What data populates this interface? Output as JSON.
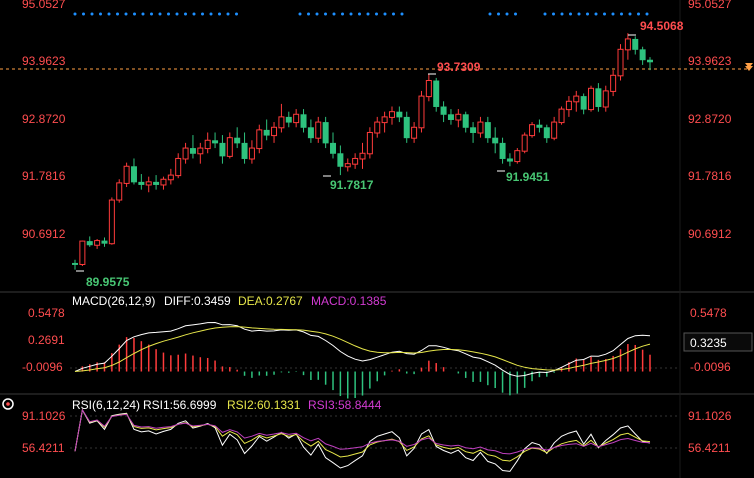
{
  "main_panel": {
    "price_axis_left": [
      "95.0527",
      "93.9623",
      "92.8720",
      "91.7816",
      "90.6912"
    ],
    "price_axis_right": [
      "95.0527",
      "93.9623",
      "92.8720",
      "91.7816",
      "90.6912"
    ],
    "current_price": "93.9623",
    "annotations": {
      "low_start": "89.9575",
      "high_mid": "93.7309",
      "low_left": "91.7817",
      "low_right": "91.9451",
      "high_last": "94.5068"
    }
  },
  "macd_panel": {
    "title": "MACD(26,12,9)",
    "diff": "DIFF:0.3459",
    "dea": "DEA:0.2767",
    "macd": "MACD:0.1385",
    "axis_left": [
      "0.5478",
      "0.2691",
      "-0.0096"
    ],
    "axis_right": [
      "0.5478",
      "0.3235",
      "-0.0096"
    ]
  },
  "rsi_panel": {
    "title": "RSI(6,12,24)",
    "rsi1": "RSI1:56.6999",
    "rsi2": "RSI2:60.1331",
    "rsi3": "RSI3:58.8444",
    "axis_left": [
      "91.1026",
      "56.4211"
    ],
    "axis_right": [
      "91.1026",
      "56.4211"
    ]
  },
  "colors": {
    "up": "#ff3b3b",
    "down": "#2ec27e",
    "diff_line": "#ffffff",
    "dea_line": "#e6e64a",
    "macd_label": "#d23bd2",
    "rsi3_line": "#c040c0",
    "dots": "#1e90ff",
    "axis_text": "#ff4d4f",
    "current_line": "#ff9f45"
  },
  "chart_data": {
    "type": "candlestick",
    "candles": [
      [
        90.08,
        90.15,
        89.96,
        90.07
      ],
      [
        90.06,
        90.52,
        90.03,
        90.51
      ],
      [
        90.5,
        90.6,
        90.4,
        90.44
      ],
      [
        90.43,
        90.55,
        90.36,
        90.52
      ],
      [
        90.51,
        90.58,
        90.4,
        90.47
      ],
      [
        90.46,
        91.35,
        90.44,
        91.3
      ],
      [
        91.3,
        91.7,
        91.25,
        91.63
      ],
      [
        91.62,
        92.02,
        91.55,
        91.95
      ],
      [
        91.94,
        92.1,
        91.6,
        91.65
      ],
      [
        91.64,
        91.8,
        91.5,
        91.6
      ],
      [
        91.59,
        91.75,
        91.45,
        91.65
      ],
      [
        91.64,
        91.78,
        91.5,
        91.6
      ],
      [
        91.59,
        91.75,
        91.5,
        91.7
      ],
      [
        91.69,
        91.9,
        91.6,
        91.78
      ],
      [
        91.77,
        92.2,
        91.72,
        92.1
      ],
      [
        92.09,
        92.4,
        92.0,
        92.3
      ],
      [
        92.29,
        92.55,
        92.1,
        92.2
      ],
      [
        92.19,
        92.4,
        92.0,
        92.3
      ],
      [
        92.29,
        92.6,
        92.2,
        92.45
      ],
      [
        92.44,
        92.6,
        92.3,
        92.4
      ],
      [
        92.39,
        92.55,
        92.0,
        92.15
      ],
      [
        92.14,
        92.6,
        92.1,
        92.5
      ],
      [
        92.49,
        92.7,
        92.3,
        92.4
      ],
      [
        92.39,
        92.6,
        92.0,
        92.1
      ],
      [
        92.09,
        92.45,
        92.0,
        92.3
      ],
      [
        92.29,
        92.75,
        92.2,
        92.65
      ],
      [
        92.64,
        92.85,
        92.45,
        92.55
      ],
      [
        92.54,
        92.8,
        92.4,
        92.7
      ],
      [
        92.69,
        93.15,
        92.6,
        92.9
      ],
      [
        92.89,
        93.0,
        92.7,
        92.8
      ],
      [
        92.79,
        93.05,
        92.7,
        92.95
      ],
      [
        92.94,
        93.05,
        92.6,
        92.7
      ],
      [
        92.69,
        92.85,
        92.4,
        92.5
      ],
      [
        92.49,
        92.9,
        92.4,
        92.8
      ],
      [
        92.79,
        92.9,
        92.3,
        92.4
      ],
      [
        92.39,
        92.6,
        92.1,
        92.2
      ],
      [
        92.19,
        92.35,
        91.78,
        91.95
      ],
      [
        91.94,
        92.1,
        91.85,
        92.0
      ],
      [
        91.99,
        92.2,
        91.9,
        92.1
      ],
      [
        92.09,
        92.4,
        91.9,
        92.2
      ],
      [
        92.19,
        92.7,
        92.1,
        92.6
      ],
      [
        92.59,
        92.9,
        92.5,
        92.8
      ],
      [
        92.79,
        93.0,
        92.6,
        92.9
      ],
      [
        92.89,
        93.1,
        92.75,
        93.0
      ],
      [
        92.99,
        93.1,
        92.8,
        92.9
      ],
      [
        92.89,
        93.0,
        92.4,
        92.5
      ],
      [
        92.49,
        92.8,
        92.4,
        92.7
      ],
      [
        92.69,
        93.4,
        92.6,
        93.3
      ],
      [
        93.29,
        93.73,
        93.2,
        93.6
      ],
      [
        93.59,
        93.65,
        93.0,
        93.1
      ],
      [
        93.09,
        93.2,
        92.8,
        92.95
      ],
      [
        92.94,
        93.05,
        92.75,
        92.85
      ],
      [
        92.84,
        93.05,
        92.7,
        92.95
      ],
      [
        92.94,
        93.0,
        92.6,
        92.7
      ],
      [
        92.69,
        92.8,
        92.4,
        92.6
      ],
      [
        92.59,
        92.9,
        92.5,
        92.8
      ],
      [
        92.79,
        92.9,
        92.4,
        92.5
      ],
      [
        92.49,
        92.7,
        92.2,
        92.4
      ],
      [
        92.39,
        92.5,
        92.0,
        92.1
      ],
      [
        92.09,
        92.2,
        91.95,
        92.05
      ],
      [
        92.04,
        92.3,
        92.0,
        92.25
      ],
      [
        92.24,
        92.6,
        92.2,
        92.55
      ],
      [
        92.54,
        92.8,
        92.5,
        92.75
      ],
      [
        92.74,
        92.85,
        92.6,
        92.7
      ],
      [
        92.69,
        92.75,
        92.4,
        92.5
      ],
      [
        92.49,
        92.9,
        92.45,
        92.8
      ],
      [
        92.79,
        93.1,
        92.75,
        93.05
      ],
      [
        93.04,
        93.3,
        92.9,
        93.2
      ],
      [
        93.19,
        93.4,
        93.0,
        93.3
      ],
      [
        93.29,
        93.35,
        92.95,
        93.05
      ],
      [
        93.04,
        93.5,
        93.0,
        93.45
      ],
      [
        93.44,
        93.55,
        93.0,
        93.1
      ],
      [
        93.09,
        93.5,
        93.0,
        93.4
      ],
      [
        93.39,
        93.8,
        93.3,
        93.7
      ],
      [
        93.69,
        94.3,
        93.6,
        94.2
      ],
      [
        94.19,
        94.51,
        94.0,
        94.4
      ],
      [
        94.39,
        94.45,
        94.1,
        94.2
      ],
      [
        94.19,
        94.25,
        93.9,
        94.0
      ],
      [
        93.99,
        94.05,
        93.8,
        93.96
      ]
    ],
    "annotations": [
      {
        "label": "89.9575",
        "value": 89.9575
      },
      {
        "label": "93.7309",
        "value": 93.7309
      },
      {
        "label": "91.7817",
        "value": 91.7817
      },
      {
        "label": "91.9451",
        "value": 91.9451
      },
      {
        "label": "94.5068",
        "value": 94.5068
      }
    ],
    "price_range": [
      95.0527,
      89.8
    ],
    "macd_range": [
      0.65,
      -0.18
    ],
    "rsi_range": [
      100,
      20
    ]
  }
}
